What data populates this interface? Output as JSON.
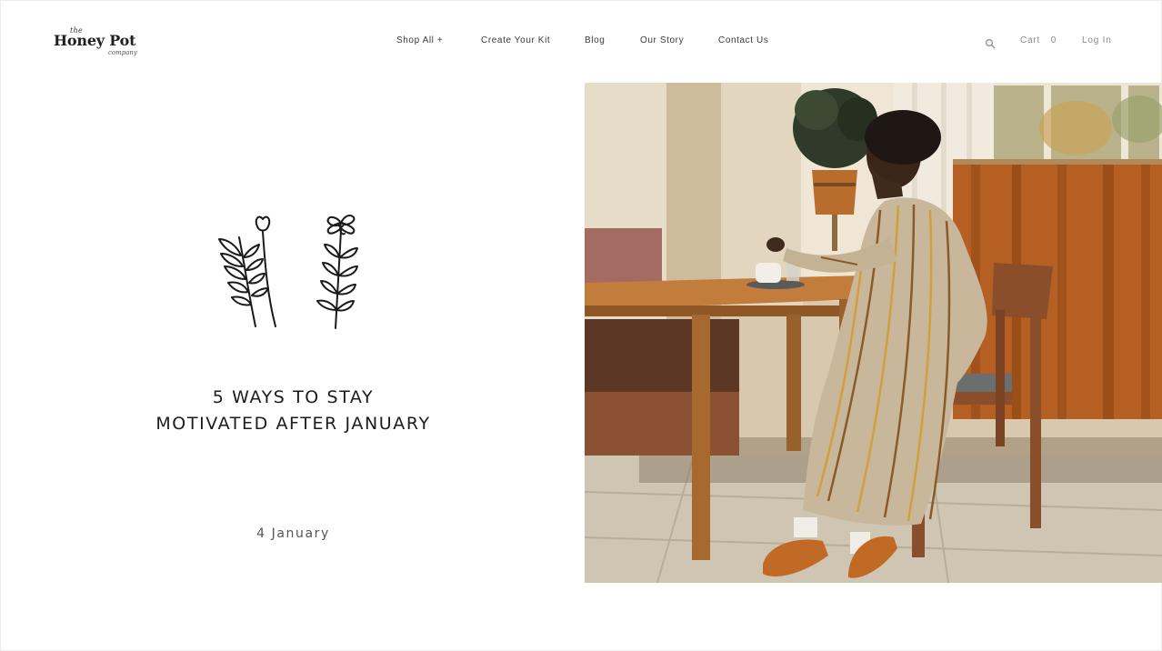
{
  "brand": {
    "logo_the": "the",
    "logo_main": "Honey Pot",
    "logo_sub": "company"
  },
  "nav": {
    "items": [
      {
        "label": "Shop All +"
      },
      {
        "label": "Create Your Kit"
      },
      {
        "label": "Blog"
      },
      {
        "label": "Our Story"
      },
      {
        "label": "Contact Us"
      }
    ]
  },
  "utility": {
    "search_icon": "search-icon",
    "cart_label": "Cart",
    "cart_count": "0",
    "login_label": "Log In"
  },
  "article": {
    "title_line1": "5 WAYS TO STAY",
    "title_line2": "MOTIVATED AFTER JANUARY",
    "date": "4 January",
    "illustration_icon": "botanical-illustration"
  },
  "colors": {
    "text_dark": "#1c1c1c",
    "text_muted": "#8a8a8a",
    "curtain": "#b65f22",
    "wood": "#a86a2f"
  }
}
